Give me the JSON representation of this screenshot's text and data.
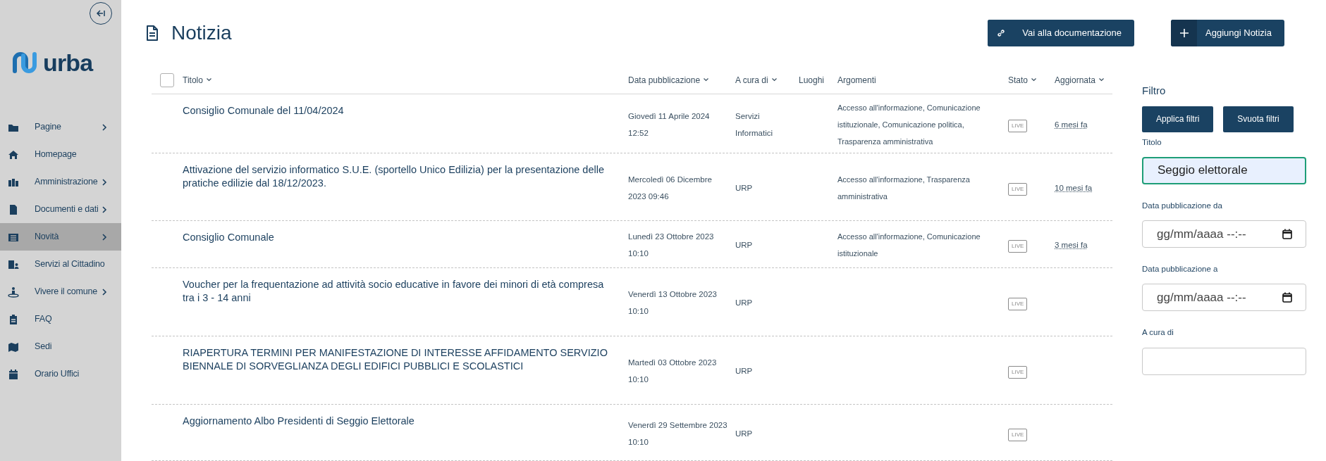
{
  "sidebar": {
    "logo": "urba",
    "items": [
      {
        "label": "Pagine",
        "expandable": true,
        "selected": false
      },
      {
        "label": "Homepage",
        "expandable": false,
        "selected": false
      },
      {
        "label": "Amministrazione",
        "expandable": true,
        "selected": false
      },
      {
        "label": "Documenti e dati",
        "expandable": true,
        "selected": false
      },
      {
        "label": "Novità",
        "expandable": true,
        "selected": true
      },
      {
        "label": "Servizi al Cittadino",
        "expandable": false,
        "selected": false
      },
      {
        "label": "Vivere il comune",
        "expandable": true,
        "selected": false
      },
      {
        "label": "FAQ",
        "expandable": false,
        "selected": false
      },
      {
        "label": "Sedi",
        "expandable": false,
        "selected": false
      },
      {
        "label": "Orario Uffici",
        "expandable": false,
        "selected": false
      }
    ]
  },
  "page_title": "Notizia",
  "actions": [
    {
      "label": "Vai alla documentazione",
      "kind": "link"
    },
    {
      "label": "Aggiungi Notizia",
      "kind": "add"
    }
  ],
  "table": {
    "select_all_checked": false,
    "columns": [
      {
        "label": "Titolo",
        "sortable": true
      },
      {
        "label": "Data pubblicazione",
        "sortable": true
      },
      {
        "label": "A cura di",
        "sortable": true
      },
      {
        "label": "Luoghi",
        "sortable": false
      },
      {
        "label": "Argomenti",
        "sortable": false
      },
      {
        "label": "Stato",
        "sortable": true
      },
      {
        "label": "Aggiornata",
        "sortable": true
      }
    ],
    "rows": [
      {
        "title": "Consiglio Comunale del 11/04/2024",
        "date": "Giovedì 11 Aprile 2024 12:52",
        "author": "Servizi Informatici",
        "topics": "Accesso all'informazione, Comunicazione istituzionale, Comunicazione politica, Trasparenza amministrativa",
        "status": "LIVE",
        "updated": "6 mesi fa"
      },
      {
        "title": "Attivazione del servizio informatico S.U.E. (sportello Unico Edilizia) per la presentazione delle pratiche edilizie dal 18/12/2023.",
        "date": "Mercoledì 06 Dicembre 2023 09:46",
        "author": "URP",
        "topics": "Accesso all'informazione, Trasparenza amministrativa",
        "status": "LIVE",
        "updated": "10 mesi fa"
      },
      {
        "title": "Consiglio Comunale",
        "date": "Lunedì 23 Ottobre 2023 10:10",
        "author": "URP",
        "topics": "Accesso all'informazione, Comunicazione istituzionale",
        "status": "LIVE",
        "updated": "3 mesi fa"
      },
      {
        "title": "Voucher per la frequentazione ad attività socio educative in favore dei minori di età compresa tra i 3 - 14 anni",
        "date": "Venerdì 13 Ottobre 2023 10:10",
        "author": "URP",
        "status": "LIVE"
      },
      {
        "title": "RIAPERTURA TERMINI PER MANIFESTAZIONE DI INTERESSE AFFIDAMENTO SERVIZIO BIENNALE DI SORVEGLIANZA DEGLI EDIFICI PUBBLICI E SCOLASTICI",
        "date": "Martedì 03 Ottobre 2023 10:10",
        "author": "URP",
        "status": "LIVE"
      },
      {
        "title": "Aggiornamento Albo Presidenti di Seggio Elettorale",
        "date": "Venerdì 29 Settembre 2023 10:10",
        "author": "URP",
        "status": "LIVE"
      }
    ]
  },
  "filter": {
    "title": "Filtro",
    "buttons": [
      "Applica filtri",
      "Svuota filtri"
    ],
    "fields": [
      {
        "label": "Titolo",
        "kind": "text",
        "value": "Seggio elettorale",
        "focused": true
      },
      {
        "label": "Data pubblicazione da",
        "kind": "datetime",
        "placeholder": "gg/mm/aaaa --:--",
        "focused": false
      },
      {
        "label": "Data pubblicazione a",
        "kind": "datetime",
        "placeholder": "gg/mm/aaaa --:--",
        "focused": false
      },
      {
        "label": "A cura di",
        "kind": "text",
        "focused": false
      }
    ]
  }
}
